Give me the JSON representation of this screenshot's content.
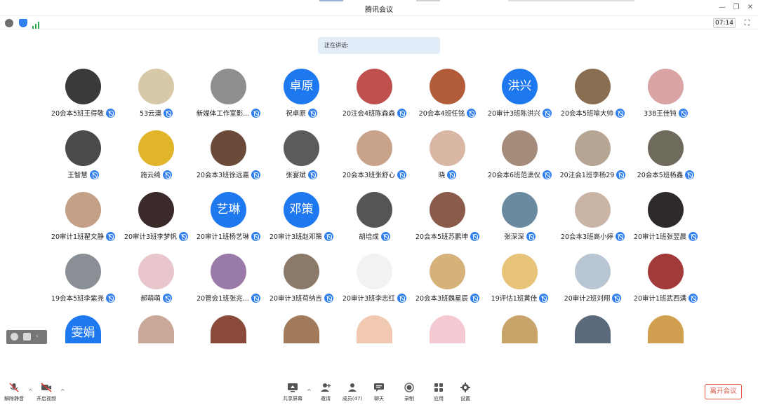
{
  "window": {
    "title": "腾讯会议"
  },
  "status": {
    "timer": "07:14"
  },
  "speaking": {
    "label": "正在讲话:"
  },
  "participants": [
    {
      "name": "20会本5班王得敬",
      "avatar_text": "",
      "avatar_color": "#3a3a3a"
    },
    {
      "name": "53云澳",
      "avatar_text": "",
      "avatar_color": "#d7c9a8"
    },
    {
      "name": "新媒体工作室影...",
      "avatar_text": "",
      "avatar_color": "#8f8f8f"
    },
    {
      "name": "祝卓原",
      "avatar_text": "卓原",
      "avatar_color": "#1e78f0"
    },
    {
      "name": "20注会4班陈森森",
      "avatar_text": "",
      "avatar_color": "#c0504d"
    },
    {
      "name": "20会本4班任铭",
      "avatar_text": "",
      "avatar_color": "#b25c3a"
    },
    {
      "name": "20审计3班陈洪兴",
      "avatar_text": "洪兴",
      "avatar_color": "#1e78f0"
    },
    {
      "name": "20会本5班喻大帅",
      "avatar_text": "",
      "avatar_color": "#8a6e52"
    },
    {
      "name": "338王佳钝",
      "avatar_text": "",
      "avatar_color": "#d9a4a4"
    },
    {
      "name": "王智慧",
      "avatar_text": "",
      "avatar_color": "#4a4a4a"
    },
    {
      "name": "施云绮",
      "avatar_text": "",
      "avatar_color": "#e0b52a"
    },
    {
      "name": "20会本3班徐远嘉",
      "avatar_text": "",
      "avatar_color": "#6b4a3a"
    },
    {
      "name": "张宴斌",
      "avatar_text": "",
      "avatar_color": "#5b5b5b"
    },
    {
      "name": "20会本3班张舒心",
      "avatar_text": "",
      "avatar_color": "#c9a28a"
    },
    {
      "name": "晓",
      "avatar_text": "",
      "avatar_color": "#d9b6a3"
    },
    {
      "name": "20会本6班范潇仪",
      "avatar_text": "",
      "avatar_color": "#a58b7a"
    },
    {
      "name": "20注会1班李杨29",
      "avatar_text": "",
      "avatar_color": "#b5a592"
    },
    {
      "name": "20会本5班杨鑫",
      "avatar_text": "",
      "avatar_color": "#6e6a5c"
    },
    {
      "name": "20审计1班翟文静",
      "avatar_text": "",
      "avatar_color": "#c4a087"
    },
    {
      "name": "20审计3班李梦帆",
      "avatar_text": "",
      "avatar_color": "#3b2a2a"
    },
    {
      "name": "20审计1班杨艺琳",
      "avatar_text": "艺琳",
      "avatar_color": "#1e78f0"
    },
    {
      "name": "20审计3班赵邓策",
      "avatar_text": "邓策",
      "avatar_color": "#1e78f0"
    },
    {
      "name": "胡培成",
      "avatar_text": "",
      "avatar_color": "#555555"
    },
    {
      "name": "20会本5班苏鹏坤",
      "avatar_text": "",
      "avatar_color": "#8a5a4a"
    },
    {
      "name": "张深深",
      "avatar_text": "",
      "avatar_color": "#6a8aa0"
    },
    {
      "name": "20会本3班高小婷",
      "avatar_text": "",
      "avatar_color": "#c9b4a6"
    },
    {
      "name": "20审计1班张翌晨",
      "avatar_text": "",
      "avatar_color": "#2e2a2a"
    },
    {
      "name": "19会本5班李紫尧",
      "avatar_text": "",
      "avatar_color": "#8a8f96"
    },
    {
      "name": "郝萌萌",
      "avatar_text": "",
      "avatar_color": "#e8c6cc"
    },
    {
      "name": "20管会1班张兆...",
      "avatar_text": "",
      "avatar_color": "#9a7aa8"
    },
    {
      "name": "20审计3班苟纳吉",
      "avatar_text": "",
      "avatar_color": "#8b7a6a"
    },
    {
      "name": "20审计3班李志红",
      "avatar_text": "",
      "avatar_color": "#f2f2f2"
    },
    {
      "name": "20会本3班魏星辰",
      "avatar_text": "",
      "avatar_color": "#d6b27a"
    },
    {
      "name": "19评估1班黄佳",
      "avatar_text": "",
      "avatar_color": "#e8c37a"
    },
    {
      "name": "20审计2班刘翔",
      "avatar_text": "",
      "avatar_color": "#b8c6d4"
    },
    {
      "name": "20审计1班武西满",
      "avatar_text": "",
      "avatar_color": "#a33a3a"
    },
    {
      "name": "",
      "avatar_text": "雯娟",
      "avatar_color": "#1e78f0"
    },
    {
      "name": "",
      "avatar_text": "",
      "avatar_color": "#c9a89a"
    },
    {
      "name": "",
      "avatar_text": "",
      "avatar_color": "#8a4a3a"
    },
    {
      "name": "",
      "avatar_text": "",
      "avatar_color": "#a07a5a"
    },
    {
      "name": "",
      "avatar_text": "",
      "avatar_color": "#f0c9b0"
    },
    {
      "name": "",
      "avatar_text": "",
      "avatar_color": "#f4c9d2"
    },
    {
      "name": "",
      "avatar_text": "",
      "avatar_color": "#c8a46a"
    },
    {
      "name": "",
      "avatar_text": "",
      "avatar_color": "#5a6a7a"
    },
    {
      "name": "",
      "avatar_text": "",
      "avatar_color": "#d0a050"
    }
  ],
  "toolbar": {
    "unmute": "解除静音",
    "start_video": "开启视频",
    "share_screen": "共享屏幕",
    "invite": "邀请",
    "members": "成员(47)",
    "chat": "聊天",
    "record": "录制",
    "apps": "应用",
    "settings": "设置",
    "leave": "离开会议"
  }
}
